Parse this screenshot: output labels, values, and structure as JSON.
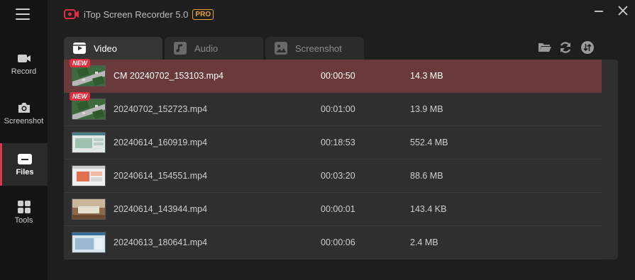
{
  "app": {
    "title": "iTop Screen Recorder 5.0",
    "badge": "PRO"
  },
  "sidebar": {
    "items": [
      {
        "label": "Record",
        "icon": "camera-icon"
      },
      {
        "label": "Screenshot",
        "icon": "camera-photo-icon"
      },
      {
        "label": "Files",
        "icon": "folder-icon",
        "active": true
      },
      {
        "label": "Tools",
        "icon": "grid-icon"
      }
    ]
  },
  "tabs": [
    {
      "label": "Video",
      "active": true
    },
    {
      "label": "Audio"
    },
    {
      "label": "Screenshot"
    }
  ],
  "badge_new": "NEW",
  "files": [
    {
      "name": "CM 20240702_153103.mp4",
      "duration": "00:00:50",
      "size": "14.3 MB",
      "new": true,
      "selected": true
    },
    {
      "name": "20240702_152723.mp4",
      "duration": "00:01:00",
      "size": "13.9 MB",
      "new": true
    },
    {
      "name": "20240614_160919.mp4",
      "duration": "00:18:53",
      "size": "552.4 MB"
    },
    {
      "name": "20240614_154551.mp4",
      "duration": "00:03:20",
      "size": "88.6 MB"
    },
    {
      "name": "20240614_143944.mp4",
      "duration": "00:00:01",
      "size": "143.4 KB"
    },
    {
      "name": "20240613_180641.mp4",
      "duration": "00:00:06",
      "size": "2.4 MB"
    }
  ],
  "colors": {
    "accent": "#d9394b",
    "selected_row": "#6a3a3a",
    "pro": "#e8a33a"
  }
}
